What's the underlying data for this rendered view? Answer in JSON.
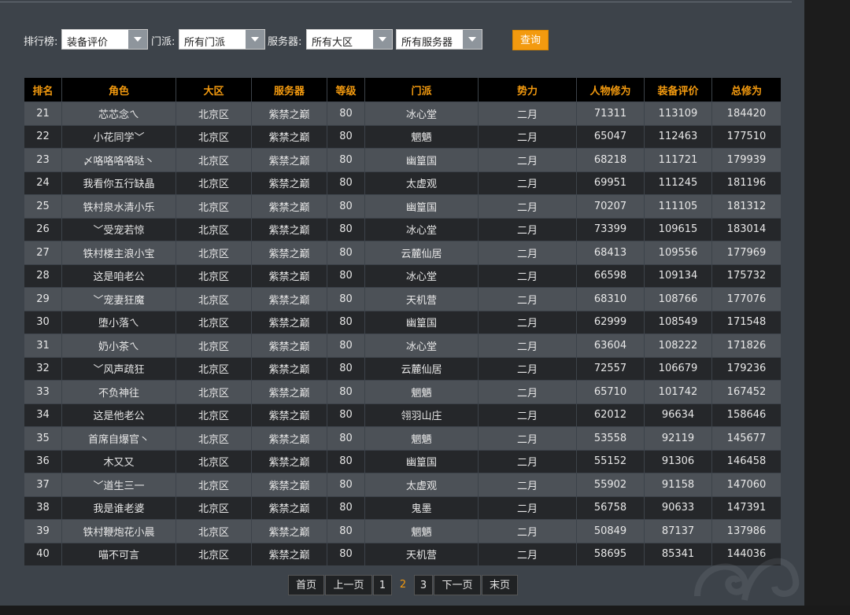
{
  "filters": {
    "rank_label": "排行榜:",
    "rank_value": "装备评价",
    "sect_label": "门派:",
    "sect_value": "所有门派",
    "server_label": "服务器:",
    "region_value": "所有大区",
    "server_value": "所有服务器",
    "query_button": "查询"
  },
  "table": {
    "headers": [
      "排名",
      "角色",
      "大区",
      "服务器",
      "等级",
      "门派",
      "势力",
      "人物修为",
      "装备评价",
      "总修为"
    ],
    "rows": [
      [
        "21",
        "芯芯念ㄟ",
        "北京区",
        "紫禁之巅",
        "80",
        "冰心堂",
        "二月",
        "71311",
        "113109",
        "184420"
      ],
      [
        "22",
        "小花同学﹀",
        "北京区",
        "紫禁之巅",
        "80",
        "魍魉",
        "二月",
        "65047",
        "112463",
        "177510"
      ],
      [
        "23",
        "〆咯咯咯咯哒丶",
        "北京区",
        "紫禁之巅",
        "80",
        "幽篁国",
        "二月",
        "68218",
        "111721",
        "179939"
      ],
      [
        "24",
        "我看你五行缺晶",
        "北京区",
        "紫禁之巅",
        "80",
        "太虚观",
        "二月",
        "69951",
        "111245",
        "181196"
      ],
      [
        "25",
        "铁村泉水清小乐",
        "北京区",
        "紫禁之巅",
        "80",
        "幽篁国",
        "二月",
        "70207",
        "111105",
        "181312"
      ],
      [
        "26",
        "﹀受宠若惊",
        "北京区",
        "紫禁之巅",
        "80",
        "冰心堂",
        "二月",
        "73399",
        "109615",
        "183014"
      ],
      [
        "27",
        "铁村楼主浪小宝",
        "北京区",
        "紫禁之巅",
        "80",
        "云麓仙居",
        "二月",
        "68413",
        "109556",
        "177969"
      ],
      [
        "28",
        "这是咱老公",
        "北京区",
        "紫禁之巅",
        "80",
        "冰心堂",
        "二月",
        "66598",
        "109134",
        "175732"
      ],
      [
        "29",
        "﹀宠妻狂魔",
        "北京区",
        "紫禁之巅",
        "80",
        "天机营",
        "二月",
        "68310",
        "108766",
        "177076"
      ],
      [
        "30",
        "堕小落ㄟ",
        "北京区",
        "紫禁之巅",
        "80",
        "幽篁国",
        "二月",
        "62999",
        "108549",
        "171548"
      ],
      [
        "31",
        "奶小茶ㄟ",
        "北京区",
        "紫禁之巅",
        "80",
        "冰心堂",
        "二月",
        "63604",
        "108222",
        "171826"
      ],
      [
        "32",
        "﹀风声疏狂",
        "北京区",
        "紫禁之巅",
        "80",
        "云麓仙居",
        "二月",
        "72557",
        "106679",
        "179236"
      ],
      [
        "33",
        "不负神往",
        "北京区",
        "紫禁之巅",
        "80",
        "魍魉",
        "二月",
        "65710",
        "101742",
        "167452"
      ],
      [
        "34",
        "这是他老公",
        "北京区",
        "紫禁之巅",
        "80",
        "翎羽山庄",
        "二月",
        "62012",
        "96634",
        "158646"
      ],
      [
        "35",
        "首席自爆官丶",
        "北京区",
        "紫禁之巅",
        "80",
        "魍魉",
        "二月",
        "53558",
        "92119",
        "145677"
      ],
      [
        "36",
        "木又又",
        "北京区",
        "紫禁之巅",
        "80",
        "幽篁国",
        "二月",
        "55152",
        "91306",
        "146458"
      ],
      [
        "37",
        "﹀道生三一",
        "北京区",
        "紫禁之巅",
        "80",
        "太虚观",
        "二月",
        "55902",
        "91158",
        "147060"
      ],
      [
        "38",
        "我是谁老婆",
        "北京区",
        "紫禁之巅",
        "80",
        "鬼墨",
        "二月",
        "56758",
        "90633",
        "147391"
      ],
      [
        "39",
        "铁村鞭炮花小晨",
        "北京区",
        "紫禁之巅",
        "80",
        "魍魉",
        "二月",
        "50849",
        "87137",
        "137986"
      ],
      [
        "40",
        "喵不可言",
        "北京区",
        "紫禁之巅",
        "80",
        "天机营",
        "二月",
        "58695",
        "85341",
        "144036"
      ]
    ]
  },
  "pager": {
    "first": "首页",
    "prev": "上一页",
    "pages": [
      "1",
      "2",
      "3"
    ],
    "current": "2",
    "next": "下一页",
    "last": "末页"
  }
}
